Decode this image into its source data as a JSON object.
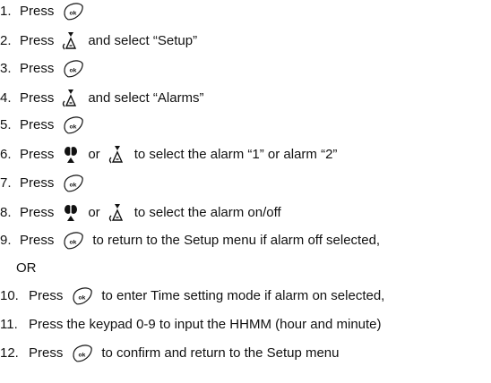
{
  "steps": [
    {
      "num": "1.",
      "parts": [
        {
          "t": "Press"
        },
        {
          "icon": "ok-icon"
        }
      ]
    },
    {
      "num": "2.",
      "parts": [
        {
          "t": "Press"
        },
        {
          "icon": "down-arrow-icon"
        },
        {
          "t": "and select “Setup”"
        }
      ]
    },
    {
      "num": "3.",
      "parts": [
        {
          "t": "Press"
        },
        {
          "icon": "ok-icon"
        }
      ]
    },
    {
      "num": "4.",
      "parts": [
        {
          "t": "Press"
        },
        {
          "icon": "down-arrow-icon"
        },
        {
          "t": "and select “Alarms”"
        }
      ]
    },
    {
      "num": "5.",
      "parts": [
        {
          "t": "Press"
        },
        {
          "icon": "ok-icon"
        }
      ]
    },
    {
      "num": "6.",
      "parts": [
        {
          "t": "Press"
        },
        {
          "icon": "up-arrow-icon"
        },
        {
          "t": "or"
        },
        {
          "icon": "down-arrow-icon"
        },
        {
          "t": "to select the alarm “1” or alarm “2”"
        }
      ]
    },
    {
      "num": "7.",
      "parts": [
        {
          "t": "Press"
        },
        {
          "icon": "ok-icon"
        }
      ]
    },
    {
      "num": "8.",
      "parts": [
        {
          "t": "Press"
        },
        {
          "icon": "up-arrow-icon"
        },
        {
          "t": "or"
        },
        {
          "icon": "down-arrow-icon"
        },
        {
          "t": "to select the alarm on/off"
        }
      ]
    },
    {
      "num": "9.",
      "parts": [
        {
          "t": "Press"
        },
        {
          "icon": "ok-icon"
        },
        {
          "t": "to return to the Setup menu if alarm off selected,"
        }
      ]
    },
    {
      "num": "10.",
      "parts": [
        {
          "t": "Press"
        },
        {
          "icon": "ok-icon"
        },
        {
          "t": "to enter Time setting mode if alarm on selected,"
        }
      ]
    },
    {
      "num": "11.",
      "parts": [
        {
          "t": "Press the keypad 0-9 to input the HHMM (hour and minute)"
        }
      ]
    },
    {
      "num": "12.",
      "parts": [
        {
          "t": "Press"
        },
        {
          "icon": "ok-icon"
        },
        {
          "t": "to confirm and return to the Setup menu"
        }
      ]
    }
  ],
  "continuation": "OR"
}
